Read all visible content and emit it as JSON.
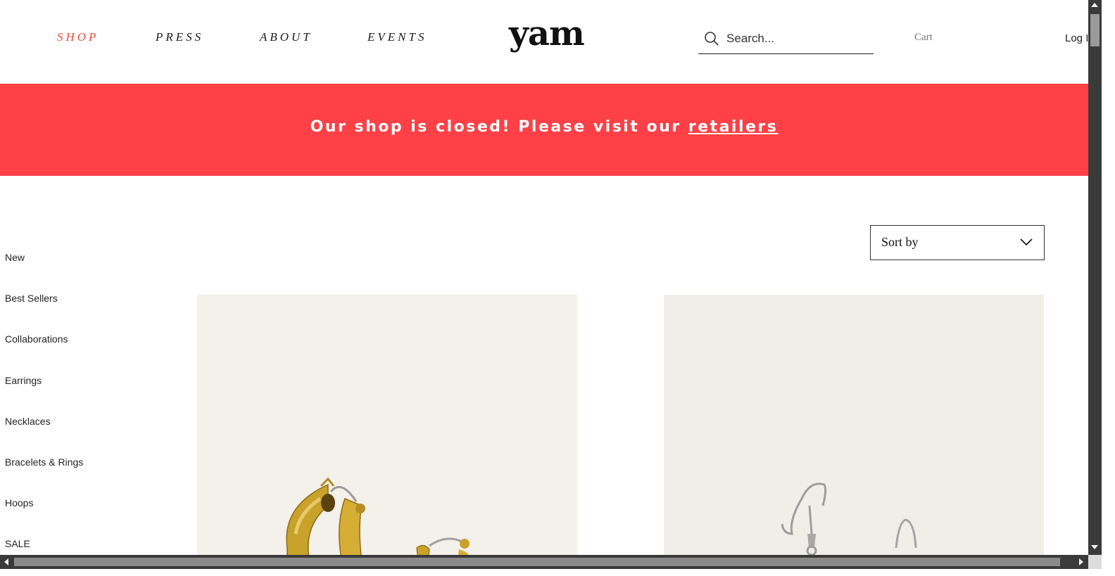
{
  "header": {
    "nav": [
      {
        "label": "SHOP",
        "active": true
      },
      {
        "label": "PRESS",
        "active": false
      },
      {
        "label": "ABOUT",
        "active": false
      },
      {
        "label": "EVENTS",
        "active": false
      }
    ],
    "logo": "yam",
    "search": {
      "placeholder": "Search...",
      "value": ""
    },
    "cart_label": "Cart",
    "login_label": "Log In"
  },
  "banner": {
    "text": "Our shop is closed! Please visit our ",
    "link_label": "retailers",
    "background_color": "#ff4046"
  },
  "sidebar": {
    "items": [
      {
        "label": "New"
      },
      {
        "label": "Best Sellers"
      },
      {
        "label": "Collaborations"
      },
      {
        "label": "Earrings"
      },
      {
        "label": "Necklaces"
      },
      {
        "label": "Bracelets & Rings"
      },
      {
        "label": "Hoops"
      },
      {
        "label": "SALE"
      }
    ]
  },
  "sort": {
    "label": "Sort by",
    "icon": "chevron-down-icon"
  },
  "products": [
    {
      "image": "gold-hoop-earrings",
      "icon": "product-image"
    },
    {
      "image": "silver-hook-earrings",
      "icon": "product-image"
    }
  ],
  "colors": {
    "accent": "#ef4b3a",
    "banner": "#ff4046",
    "product_bg": "#f4f0ea"
  }
}
